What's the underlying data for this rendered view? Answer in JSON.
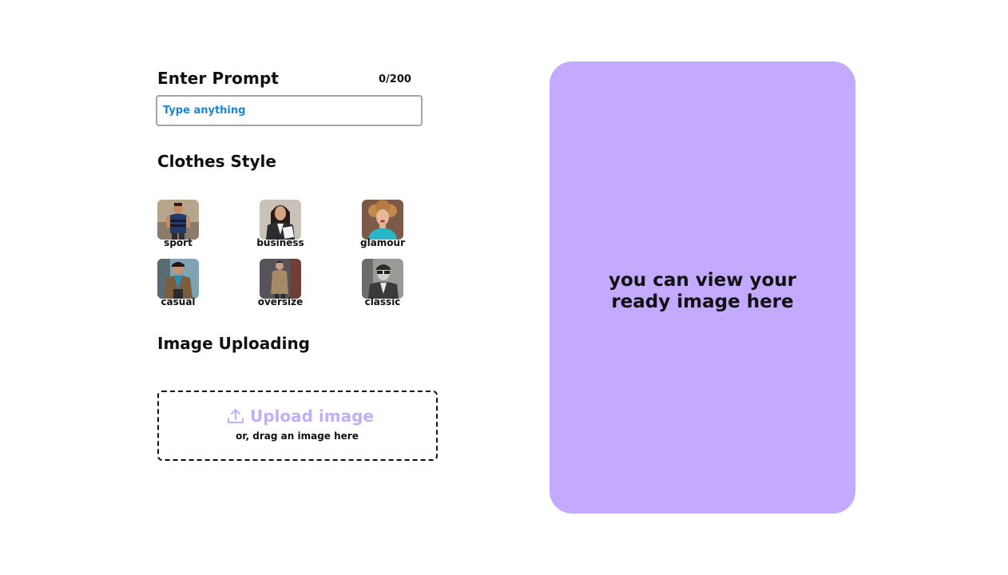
{
  "prompt": {
    "title": "Enter Prompt",
    "counter": "0/200",
    "placeholder": "Type anything",
    "value": ""
  },
  "clothes_style": {
    "title": "Clothes Style",
    "items": [
      {
        "label": "sport",
        "image": "sport-style-photo"
      },
      {
        "label": "business",
        "image": "business-style-photo"
      },
      {
        "label": "glamour",
        "image": "glamour-style-photo"
      },
      {
        "label": "casual",
        "image": "casual-style-photo"
      },
      {
        "label": "oversize",
        "image": "oversize-style-photo"
      },
      {
        "label": "classic",
        "image": "classic-style-photo"
      }
    ]
  },
  "upload": {
    "title": "Image Uploading",
    "button_label": "Upload image",
    "hint": "or, drag an image here",
    "icon": "upload-icon"
  },
  "preview": {
    "text": "you can view your\nready image here",
    "background": "#c3aaff"
  },
  "colors": {
    "accent": "#c3aefc",
    "input_text": "#1a86d8",
    "input_border": "#a6a6a6"
  }
}
